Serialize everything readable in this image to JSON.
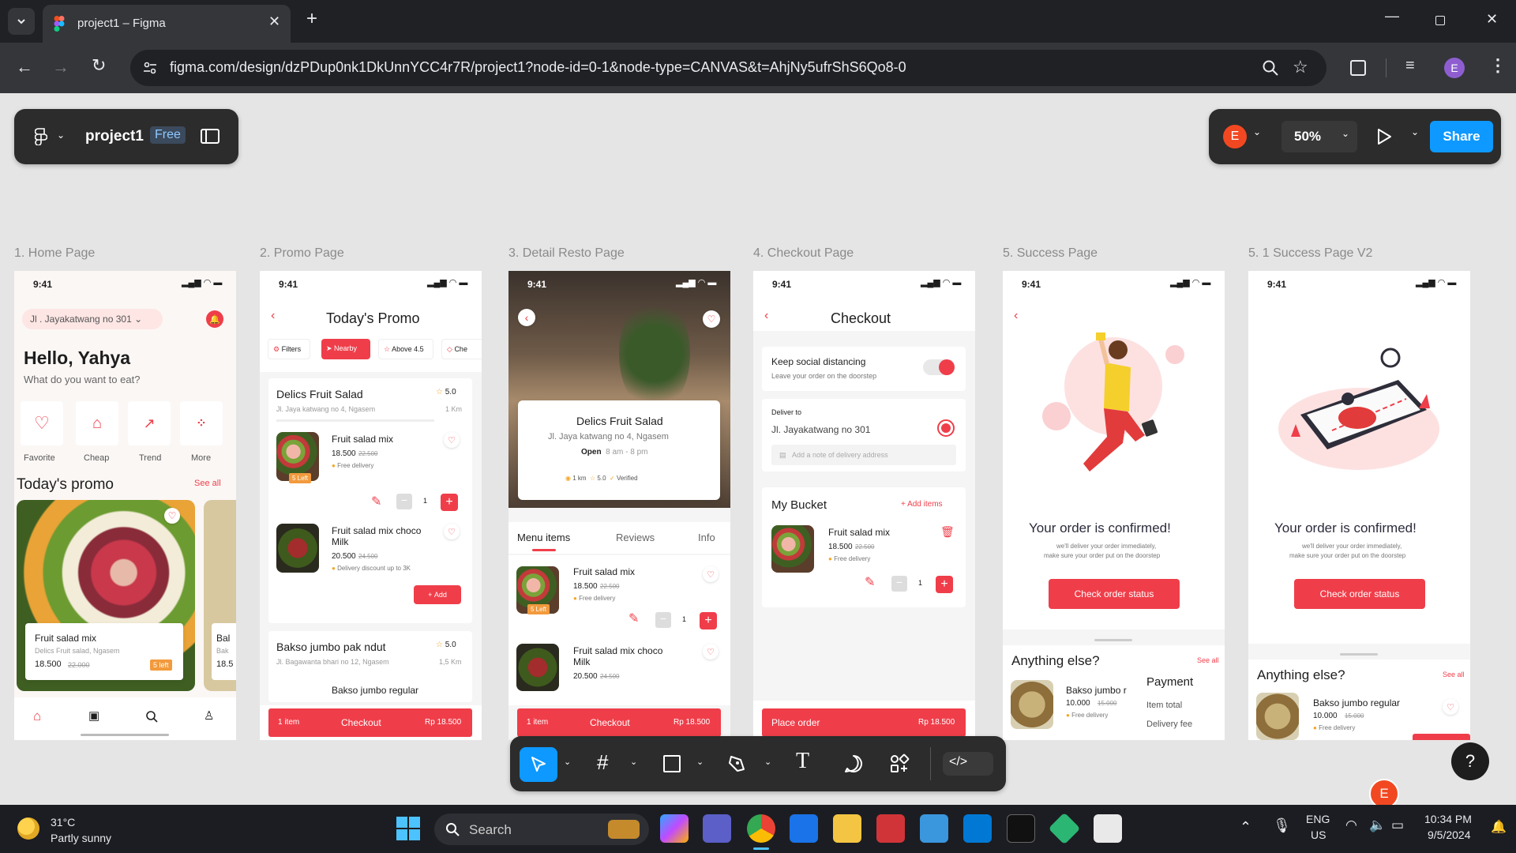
{
  "browser": {
    "tab_title": "project1 – Figma",
    "url": "figma.com/design/dzPDup0nk1DkUnnYCC4r7R/project1?node-id=0-1&node-type=CANVAS&t=AhjNy5ufrShS6Qo8-0",
    "profile_initial": "E"
  },
  "figma": {
    "file_name": "project1",
    "plan_badge": "Free",
    "user_initial": "E",
    "zoom": "50%",
    "share_label": "Share",
    "help_label": "?"
  },
  "frames": {
    "home": {
      "label": "1. Home Page",
      "time": "9:41",
      "location": "Jl . Jayakatwang no 301",
      "greeting": "Hello, Yahya",
      "question": "What do you want to eat?",
      "categories": [
        "Favorite",
        "Cheap",
        "Trend",
        "More"
      ],
      "promo_title": "Today's promo",
      "see_all": "See all",
      "promo_name": "Fruit salad mix",
      "promo_sub": "Delics Fruit salad, Ngasem",
      "promo_price": "18.500",
      "promo_old": "22.000",
      "promo_left": "5 left",
      "promo2_name": "Bal",
      "promo2_sub": "Bak",
      "promo2_price": "18.5"
    },
    "promo": {
      "label": "2. Promo Page",
      "time": "9:41",
      "title": "Today's Promo",
      "filters": [
        "Filters",
        "Nearby",
        "Above 4.5",
        "Che"
      ],
      "resto1_name": "Delics Fruit Salad",
      "resto1_rating": "5.0",
      "resto1_addr": "Jl. Jaya katwang no 4, Ngasem",
      "resto1_dist": "1 Km",
      "item1_name": "Fruit salad mix",
      "item1_price": "18.500",
      "item1_old": "22.500",
      "item1_delivery": "Free delivery",
      "item1_left": "5 Left",
      "item1_qty": "1",
      "item2_name": "Fruit salad mix choco Milk",
      "item2_price": "20.500",
      "item2_old": "24.500",
      "item2_delivery": "Delivery discount up to 3K",
      "add_label": "Add",
      "resto2_name": "Bakso jumbo pak ndut",
      "resto2_rating": "5.0",
      "resto2_addr": "Jl. Bagawanta bhari no 12, Ngasem",
      "resto2_dist": "1,5 Km",
      "item3_name": "Bakso jumbo regular",
      "bar_items": "1 item",
      "bar_checkout": "Checkout",
      "bar_total": "Rp 18.500"
    },
    "detail": {
      "label": "3. Detail Resto Page",
      "time": "9:41",
      "name": "Delics Fruit Salad",
      "addr": "Jl. Jaya katwang no 4, Ngasem",
      "open": "Open",
      "hours": "8 am - 8 pm",
      "dist": "1 km",
      "rating": "5.0",
      "verified": "Verified",
      "tabs": [
        "Menu items",
        "Reviews",
        "Info"
      ],
      "item1_name": "Fruit salad mix",
      "item1_price": "18.500",
      "item1_old": "22.500",
      "item1_delivery": "Free delivery",
      "item1_left": "5 Left",
      "item1_qty": "1",
      "item2_name": "Fruit salad mix choco Milk",
      "item2_price": "20.500",
      "item2_old": "24.500",
      "bar_items": "1 item",
      "bar_checkout": "Checkout",
      "bar_total": "Rp 18.500"
    },
    "checkout": {
      "label": "4. Checkout Page",
      "time": "9:41",
      "title": "Checkout",
      "distancing_title": "Keep social distancing",
      "distancing_sub": "Leave your order on the doorstep",
      "deliver_to": "Deliver to",
      "address": "Jl. Jayakatwang no 301",
      "note_placeholder": "Add a note of delivery address",
      "bucket_title": "My Bucket",
      "add_items": "Add items",
      "item_name": "Fruit salad mix",
      "item_price": "18.500",
      "item_old": "22.500",
      "item_delivery": "Free delivery",
      "item_qty": "1",
      "place_order": "Place order",
      "total": "Rp 18.500"
    },
    "success": {
      "label": "5. Success Page",
      "time": "9:41",
      "title": "Your order is confirmed!",
      "sub1": "we'll deliver your order immediately,",
      "sub2": "make sure your order put on the doorstep",
      "button": "Check order status",
      "anything": "Anything else?",
      "see_all": "See all",
      "item_name": "Bakso jumbo r",
      "item_price": "10.000",
      "item_old": "15.000",
      "item_delivery": "Free delivery",
      "payment": "Payment",
      "item_total": "Item total",
      "delivery_fee": "Delivery fee"
    },
    "success2": {
      "label": "5. 1 Success Page V2",
      "time": "9:41",
      "title": "Your order is confirmed!",
      "sub1": "we'll deliver your order immediately,",
      "sub2": "make sure your order put on the doorstep",
      "button": "Check order status",
      "anything": "Anything else?",
      "see_all": "See all",
      "item_name": "Bakso jumbo regular",
      "item_price": "10.000",
      "item_old": "15.000",
      "item_delivery": "Free delivery"
    }
  },
  "taskbar": {
    "weather_temp": "31°C",
    "weather_desc": "Partly sunny",
    "search": "Search",
    "lang1": "ENG",
    "lang2": "US",
    "time": "10:34 PM",
    "date": "9/5/2024"
  },
  "colors": {
    "accent_red": "#ef3e4a",
    "figma_blue": "#0d99ff",
    "figma_toolbar": "#2c2c2c"
  }
}
